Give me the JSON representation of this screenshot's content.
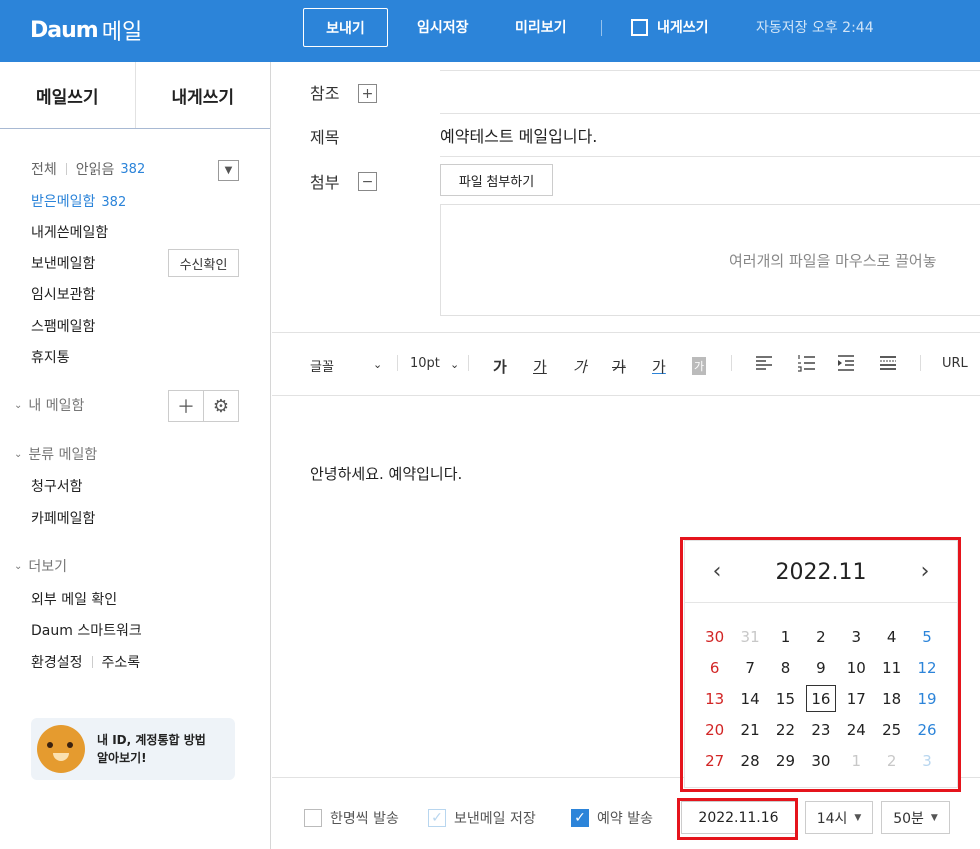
{
  "header": {
    "logo_mark": "Daum",
    "logo_text": "메일",
    "send": "보내기",
    "save_draft": "임시저장",
    "preview": "미리보기",
    "self_mail": "내게쓰기",
    "autosave": "자동저장 오후 2:44",
    "bg_color": "#2c84d9"
  },
  "sidebar": {
    "tabs": [
      "메일쓰기",
      "내게쓰기"
    ],
    "filter_all": "전체",
    "filter_unread": "안읽음",
    "unread_count": "382",
    "mailboxes": [
      {
        "label": "받은메일함",
        "count": "382"
      },
      {
        "label": "내게쓴메일함",
        "count": ""
      },
      {
        "label": "보낸메일함",
        "count": ""
      },
      {
        "label": "임시보관함",
        "count": ""
      },
      {
        "label": "스팸메일함",
        "count": ""
      },
      {
        "label": "휴지통",
        "count": ""
      }
    ],
    "receipt_button": "수신확인",
    "my_mailbox": "내 메일함",
    "category_mailbox": "분류 메일함",
    "category_items": [
      "청구서함",
      "카페메일함"
    ],
    "more": "더보기",
    "more_items": [
      "외부 메일 확인",
      "Daum 스마트워크"
    ],
    "settings": "환경설정",
    "address_book": "주소록",
    "promo": [
      "내 ID, 계정통합 방법",
      "알아보기!"
    ]
  },
  "compose": {
    "cc_label": "참조",
    "subject_label": "제목",
    "subject_value": "예약테스트 메일입니다.",
    "attach_label": "첨부",
    "attach_button": "파일 첨부하기",
    "dropzone_text": "여러개의 파일을 마우스로 끌어놓",
    "body": "안녕하세요. 예약입니다."
  },
  "toolbar": {
    "font": "글꼴",
    "size": "10pt",
    "bold": "가",
    "underline": "가",
    "italic": "가",
    "strike": "가",
    "color": "가",
    "bg": "가",
    "url": "URL"
  },
  "bottom": {
    "individual": "한명씩 발송",
    "save_sent": "보낸메일 저장",
    "reserve": "예약 발송",
    "date": "2022.11.16",
    "hour": "14시",
    "minute": "50분"
  },
  "calendar": {
    "title": "2022.11",
    "weeks": [
      [
        "30",
        "31",
        "1",
        "2",
        "3",
        "4",
        "5"
      ],
      [
        "6",
        "7",
        "8",
        "9",
        "10",
        "11",
        "12"
      ],
      [
        "13",
        "14",
        "15",
        "16",
        "17",
        "18",
        "19"
      ],
      [
        "20",
        "21",
        "22",
        "23",
        "24",
        "25",
        "26"
      ],
      [
        "27",
        "28",
        "29",
        "30",
        "1",
        "2",
        "3"
      ]
    ],
    "selected": "16"
  }
}
